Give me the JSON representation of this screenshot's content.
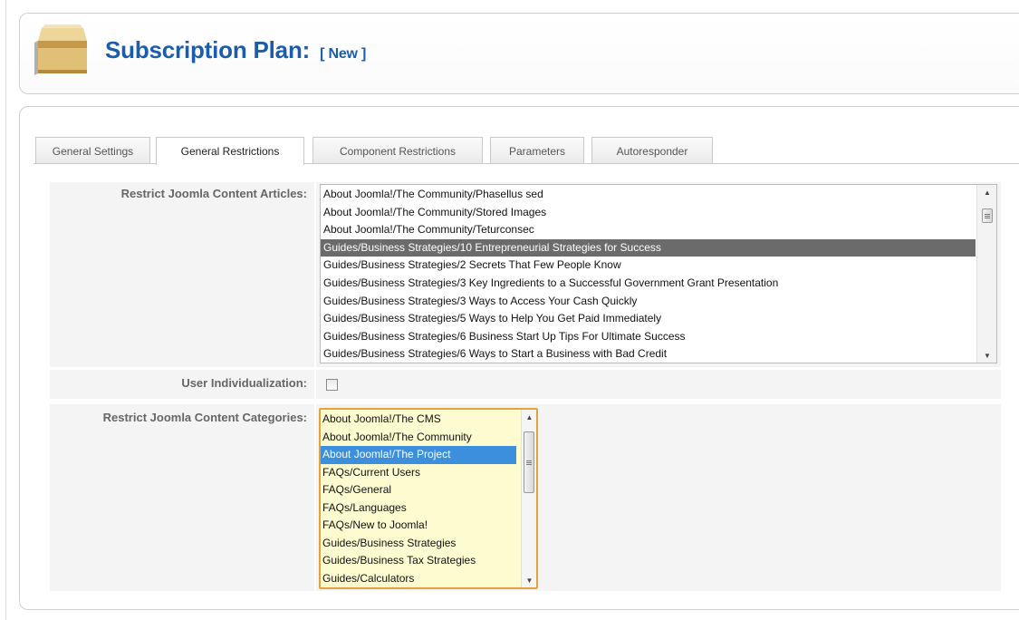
{
  "header": {
    "title": "Subscription Plan:",
    "subtitle": "[ New ]",
    "icon": "package-box-icon"
  },
  "tabs": [
    {
      "label": "General Settings",
      "active": false
    },
    {
      "label": "General Restrictions",
      "active": true
    },
    {
      "label": "Component Restrictions",
      "active": false
    },
    {
      "label": "Parameters",
      "active": false
    },
    {
      "label": "Autoresponder",
      "active": false
    }
  ],
  "articles": {
    "label": "Restrict Joomla Content Articles:",
    "options": [
      "About Joomla!/The Community/Phasellus sed",
      "About Joomla!/The Community/Stored Images",
      "About Joomla!/The Community/Teturconsec",
      "Guides/Business Strategies/10 Entrepreneurial Strategies for Success",
      "Guides/Business Strategies/2 Secrets That Few People Know",
      "Guides/Business Strategies/3 Key Ingredients to a Successful Government Grant Presentation",
      "Guides/Business Strategies/3 Ways to Access Your Cash Quickly",
      "Guides/Business Strategies/5 Ways to Help You Get Paid Immediately",
      "Guides/Business Strategies/6 Business Start Up Tips For Ultimate Success",
      "Guides/Business Strategies/6 Ways to Start a Business with Bad Credit"
    ],
    "selected_index": 3
  },
  "individualization": {
    "label": "User Individualization:",
    "checked": false
  },
  "categories": {
    "label": "Restrict Joomla Content Categories:",
    "options": [
      "About Joomla!/The CMS",
      "About Joomla!/The Community",
      "About Joomla!/The Project",
      "FAQs/Current Users",
      "FAQs/General",
      "FAQs/Languages",
      "FAQs/New to Joomla!",
      "Guides/Business Strategies",
      "Guides/Business Tax Strategies",
      "Guides/Calculators"
    ],
    "selected_index": 2
  },
  "colors": {
    "title": "#1a5dad",
    "article_selection": "#6b6b6b",
    "category_selection": "#3b8fdc",
    "category_border": "#e3a33a",
    "category_background": "#fffbd0"
  }
}
